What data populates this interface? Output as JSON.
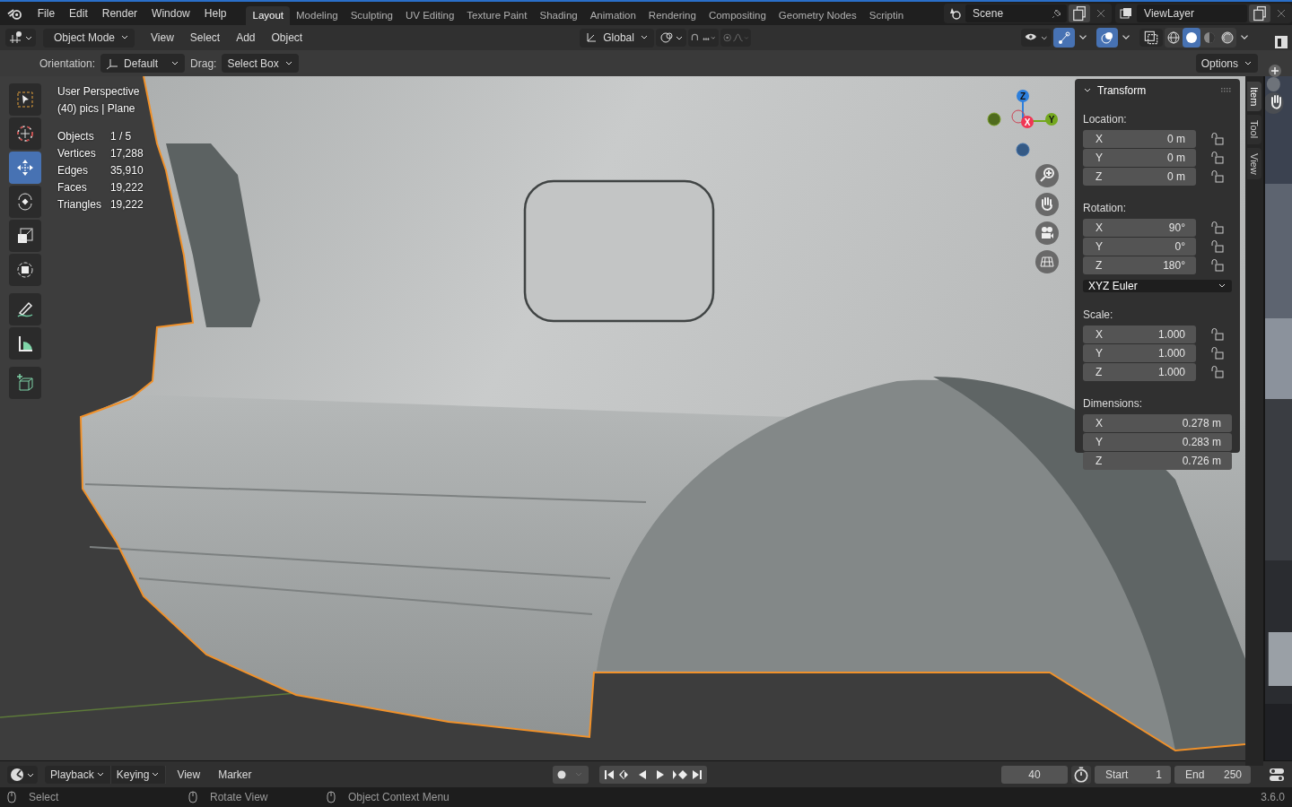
{
  "app_menu": [
    "File",
    "Edit",
    "Render",
    "Window",
    "Help"
  ],
  "workspaces": [
    {
      "label": "Layout",
      "selected": true
    },
    {
      "label": "Modeling",
      "selected": false
    },
    {
      "label": "Sculpting",
      "selected": false
    },
    {
      "label": "UV Editing",
      "selected": false
    },
    {
      "label": "Texture Paint",
      "selected": false
    },
    {
      "label": "Shading",
      "selected": false
    },
    {
      "label": "Animation",
      "selected": false
    },
    {
      "label": "Rendering",
      "selected": false
    },
    {
      "label": "Compositing",
      "selected": false
    },
    {
      "label": "Geometry Nodes",
      "selected": false
    },
    {
      "label": "Scriptin",
      "selected": false
    }
  ],
  "scene": "Scene",
  "view_layer": "ViewLayer",
  "header": {
    "mode": "Object Mode",
    "menus": [
      "View",
      "Select",
      "Add",
      "Object"
    ],
    "orientation": "Global",
    "show_gizmo": true,
    "show_overlays": true,
    "shading": [
      {
        "kind": "wireframe",
        "selected": false
      },
      {
        "kind": "solid",
        "selected": true
      },
      {
        "kind": "material",
        "selected": false
      },
      {
        "kind": "rendered",
        "selected": false
      }
    ]
  },
  "tool_settings": {
    "orientation_label": "Orientation:",
    "orientation": "Default",
    "drag_label": "Drag:",
    "drag": "Select Box",
    "options": "Options"
  },
  "toolbar_groups": [
    {
      "tools": [
        {
          "kind": "select_box",
          "selected": false
        },
        {
          "kind": "cursor",
          "selected": false
        },
        {
          "kind": "move",
          "selected": true
        },
        {
          "kind": "rotate",
          "selected": false
        },
        {
          "kind": "scale",
          "selected": false
        },
        {
          "kind": "transform",
          "selected": false
        }
      ]
    },
    {
      "tools": [
        {
          "kind": "annotate",
          "selected": false
        },
        {
          "kind": "measure",
          "selected": false
        }
      ]
    },
    {
      "tools": [
        {
          "kind": "add_cube",
          "selected": false
        }
      ]
    }
  ],
  "overlay_info": {
    "view": "User Perspective",
    "object": "(40) pics | Plane",
    "stats": [
      {
        "label": "Objects",
        "value": "1 / 5"
      },
      {
        "label": "Vertices",
        "value": "17,288"
      },
      {
        "label": "Edges",
        "value": "35,910"
      },
      {
        "label": "Faces",
        "value": "19,222"
      },
      {
        "label": "Triangles",
        "value": "19,222"
      }
    ]
  },
  "gizmo_axes": [
    {
      "label": "Z"
    },
    {
      "label": "X"
    },
    {
      "label": "Y"
    }
  ],
  "transform": {
    "title": "Transform",
    "location": {
      "label": "Location:",
      "fields": [
        {
          "axis": "X",
          "value": "0 m",
          "locked": false
        },
        {
          "axis": "Y",
          "value": "0 m",
          "locked": false
        },
        {
          "axis": "Z",
          "value": "0 m",
          "locked": false
        }
      ]
    },
    "rotation": {
      "label": "Rotation:",
      "fields": [
        {
          "axis": "X",
          "value": "90°",
          "locked": false
        },
        {
          "axis": "Y",
          "value": "0°",
          "locked": false
        },
        {
          "axis": "Z",
          "value": "180°",
          "locked": false
        }
      ]
    },
    "rotation_mode": "XYZ Euler",
    "scale": {
      "label": "Scale:",
      "fields": [
        {
          "axis": "X",
          "value": "1.000",
          "locked": false
        },
        {
          "axis": "Y",
          "value": "1.000",
          "locked": false
        },
        {
          "axis": "Z",
          "value": "1.000",
          "locked": false
        }
      ]
    },
    "dimensions": {
      "label": "Dimensions:",
      "fields": [
        {
          "axis": "X",
          "value": "0.278 m"
        },
        {
          "axis": "Y",
          "value": "0.283 m"
        },
        {
          "axis": "Z",
          "value": "0.726 m"
        }
      ]
    }
  },
  "sidebar_tabs": [
    {
      "label": "Item",
      "selected": true
    },
    {
      "label": "Tool",
      "selected": false
    },
    {
      "label": "View",
      "selected": false
    }
  ],
  "timeline": {
    "menus": [
      "Playback",
      "Keying",
      "View",
      "Marker"
    ],
    "current_frame": "40",
    "start_label": "Start",
    "start": "1",
    "end_label": "End",
    "end": "250"
  },
  "status": [
    {
      "label": "Select"
    },
    {
      "label": "Rotate View"
    },
    {
      "label": "Object Context Menu"
    }
  ],
  "version": "3.6.0"
}
